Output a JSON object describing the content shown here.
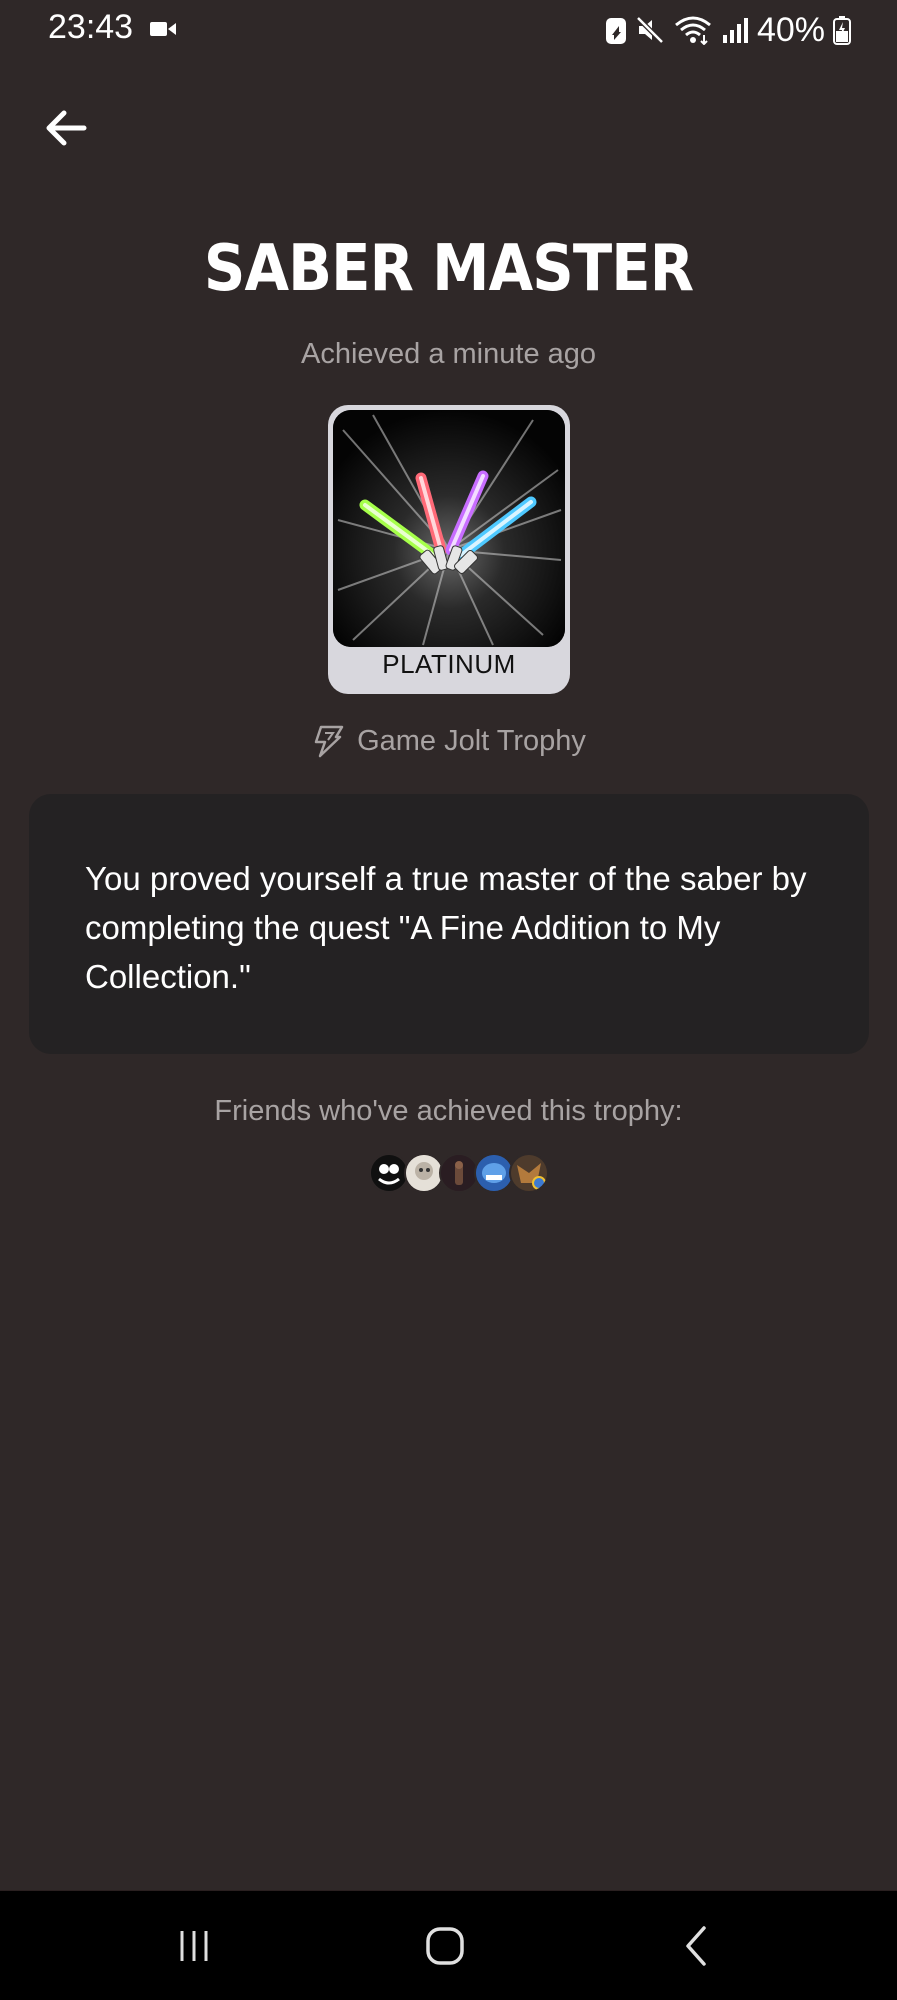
{
  "status_bar": {
    "time": "23:43",
    "battery_percent": "40%",
    "icons": [
      "video-camera-icon",
      "battery-saver-icon",
      "mute-icon",
      "wifi-icon",
      "signal-icon",
      "battery-icon"
    ]
  },
  "header": {
    "back_icon": "arrow-left-icon"
  },
  "trophy": {
    "title": "SABER MASTER",
    "achieved": "Achieved a minute ago",
    "tier": "PLATINUM",
    "type": "Game Jolt Trophy",
    "description": "You proved yourself a true master of the saber by completing the quest \"A Fine Addition to My Collection.\""
  },
  "friends": {
    "label": "Friends who've achieved this trophy:",
    "avatar_count": 5
  },
  "nav_bar": {
    "icons": [
      "recent-apps-icon",
      "home-icon",
      "back-icon"
    ]
  },
  "colors": {
    "background": "#2f2828",
    "card": "#242223",
    "muted_text": "#a8a3a3",
    "tier_badge": "#d8d7dd"
  }
}
